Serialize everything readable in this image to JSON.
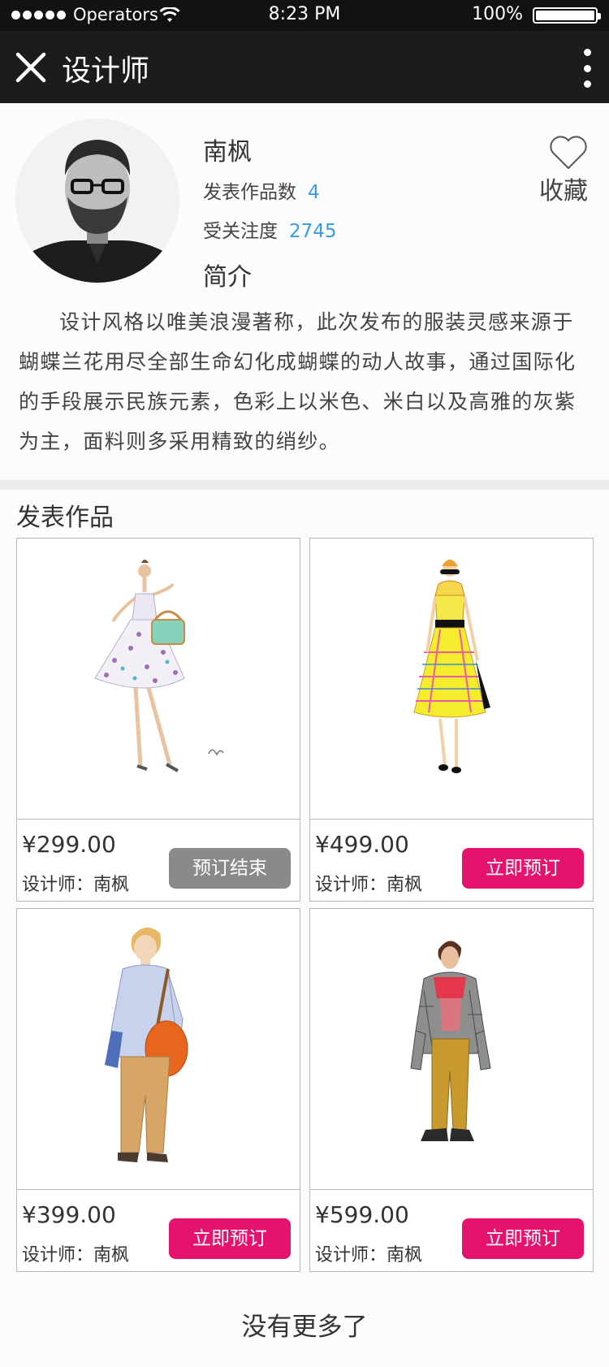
{
  "status_bar": {
    "carrier": "Operators",
    "time": "8:23 PM",
    "battery": "100%"
  },
  "nav": {
    "title": "设计师"
  },
  "designer": {
    "name": "南枫",
    "works_label": "发表作品数",
    "works_count": "4",
    "attention_label": "受关注度",
    "attention_count": "2745",
    "intro_label": "简介",
    "favorite_label": "收藏",
    "bio": "设计风格以唯美浪漫著称，此次发布的服装灵感来源于蝴蝶兰花用尽全部生命幻化成蝴蝶的动人故事，通过国际化的手段展示民族元素，色彩上以米色、米白以及高雅的灰紫为主，面料则多采用精致的绡纱。"
  },
  "works_section": {
    "title": "发表作品"
  },
  "works": [
    {
      "price": "¥299.00",
      "designer": "设计师：南枫",
      "button": "预订结束",
      "status": "ended"
    },
    {
      "price": "¥499.00",
      "designer": "设计师：南枫",
      "button": "立即预订",
      "status": "open"
    },
    {
      "price": "¥399.00",
      "designer": "设计师：南枫",
      "button": "立即预订",
      "status": "open"
    },
    {
      "price": "¥599.00",
      "designer": "设计师：南枫",
      "button": "立即预订",
      "status": "open"
    }
  ],
  "footer": {
    "text": "没有更多了"
  },
  "colors": {
    "accent": "#e5136e",
    "disabled": "#8a8a8a",
    "link": "#3a9be0",
    "nav_bg": "#1c1c1c"
  }
}
